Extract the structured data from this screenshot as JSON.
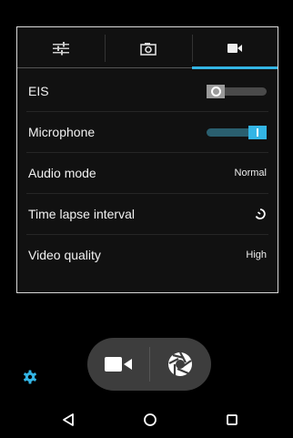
{
  "tabs": [
    {
      "icon": "sliders-icon",
      "selected": false
    },
    {
      "icon": "camera-icon",
      "selected": false
    },
    {
      "icon": "video-camera-icon",
      "selected": true
    }
  ],
  "settings": {
    "eis": {
      "label": "EIS",
      "enabled": false
    },
    "microphone": {
      "label": "Microphone",
      "enabled": true
    },
    "audio_mode": {
      "label": "Audio mode",
      "value": "Normal"
    },
    "time_lapse": {
      "label": "Time lapse interval",
      "icon": "timer-off-icon"
    },
    "video_quality": {
      "label": "Video quality",
      "value": "High"
    }
  },
  "capture": {
    "video_icon": "video-camera-icon",
    "shutter_icon": "shutter-icon"
  },
  "nav": {
    "back_icon": "back-triangle-icon",
    "home_icon": "home-circle-icon",
    "recents_icon": "recents-square-icon"
  },
  "colors": {
    "accent": "#33b5e5",
    "panel_border": "#d9d9d9",
    "background": "#000000"
  }
}
